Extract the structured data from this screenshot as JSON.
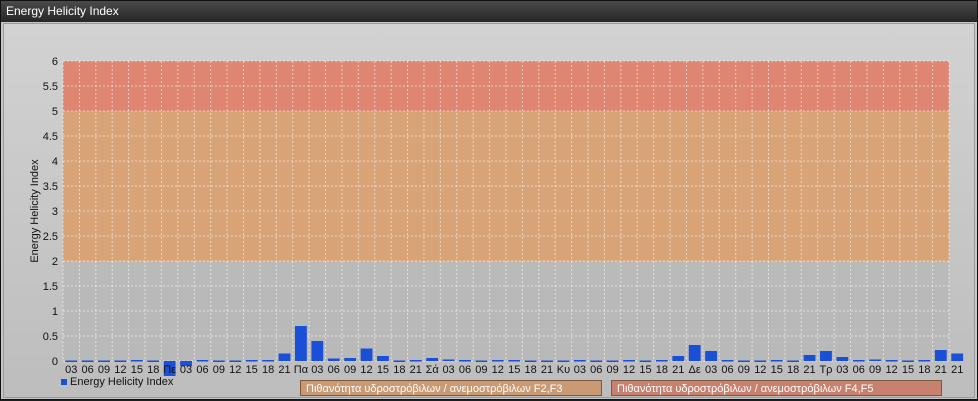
{
  "window": {
    "title": "Energy Helicity Index"
  },
  "chart_data": {
    "type": "bar",
    "ylabel": "Energy Helicity Index",
    "ylim": [
      0,
      6
    ],
    "yticks": [
      "0",
      "0.5",
      "1",
      "1.5",
      "2",
      "2.5",
      "3",
      "3.5",
      "4",
      "4.5",
      "5",
      "5.5",
      "6"
    ],
    "categories": [
      "03",
      "06",
      "09",
      "12",
      "15",
      "18",
      "Πε",
      "03",
      "06",
      "09",
      "12",
      "15",
      "18",
      "21",
      "Πα",
      "03",
      "06",
      "09",
      "12",
      "15",
      "18",
      "21",
      "Σά",
      "03",
      "06",
      "09",
      "12",
      "15",
      "18",
      "21",
      "Κυ",
      "03",
      "06",
      "09",
      "12",
      "15",
      "18",
      "21",
      "Δε",
      "03",
      "06",
      "09",
      "12",
      "15",
      "18",
      "21",
      "Τρ",
      "03",
      "06",
      "09",
      "12",
      "15",
      "18",
      "21"
    ],
    "x_labels_extra": [
      "21"
    ],
    "series": [
      {
        "name": "Energy Helicity Index",
        "color": "#1a4fd8",
        "values": [
          0.01,
          0.01,
          0.01,
          0.01,
          0.02,
          0.01,
          -0.3,
          -0.1,
          0.02,
          0.01,
          0.01,
          0.02,
          0.02,
          0.15,
          0.7,
          0.4,
          0.05,
          0.06,
          0.25,
          0.1,
          0.01,
          0.02,
          0.06,
          0.03,
          0.02,
          0.01,
          0.02,
          0.02,
          0.01,
          0.01,
          0.01,
          0.02,
          0.01,
          0.01,
          0.02,
          0.01,
          0.02,
          0.1,
          0.32,
          0.2,
          0.02,
          0.01,
          0.01,
          0.02,
          0.01,
          0.12,
          0.2,
          0.08,
          0.02,
          0.03,
          0.02,
          0.01,
          0.02,
          0.22,
          0.15
        ]
      }
    ],
    "bands": [
      {
        "from": 0,
        "to": 2,
        "color": "#b8b8b8"
      },
      {
        "from": 2,
        "to": 5,
        "color": "#d9a070"
      },
      {
        "from": 5,
        "to": 6,
        "color": "#e0806a"
      }
    ],
    "grid": true
  },
  "legend": {
    "series_label": "Energy Helicity Index",
    "prob_low": "Πιθανότητα υδροστρόβιλων / ανεμοστρόβιλων F2,F3",
    "prob_high": "Πιθανότητα υδροστρόβιλων / ανεμοστρόβιλων F4,F5",
    "prob_low_color": "#c99a73",
    "prob_high_color": "#c8816e"
  }
}
